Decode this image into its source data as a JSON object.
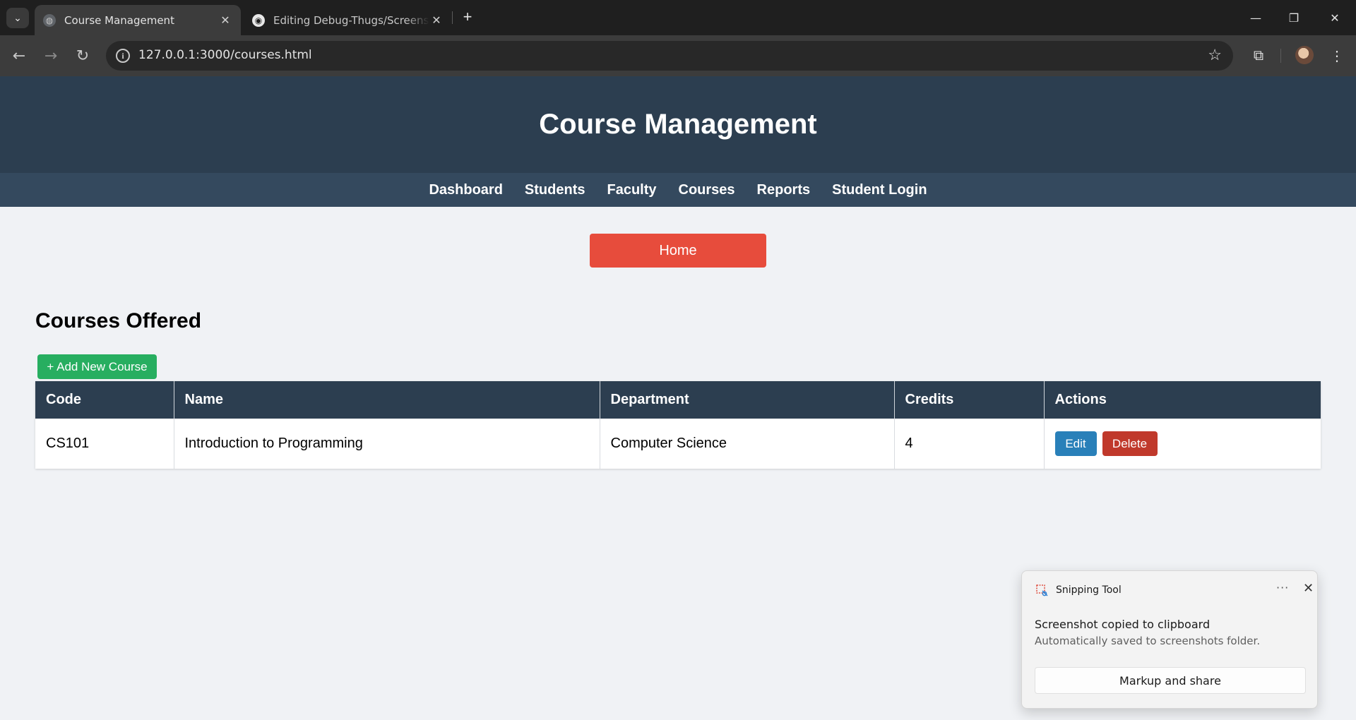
{
  "browser": {
    "tabs": [
      {
        "title": "Course Management",
        "active": true
      },
      {
        "title": "Editing Debug-Thugs/Screenshots",
        "active": false
      }
    ],
    "url": "127.0.0.1:3000/courses.html",
    "icons": {
      "tab_search": "chevron-down-icon",
      "tab_close": "close-icon",
      "new_tab": "plus-icon",
      "back": "arrow-left-icon",
      "forward": "arrow-right-icon",
      "reload": "reload-icon",
      "site_info": "info-icon",
      "bookmark": "star-icon",
      "extensions": "puzzle-icon",
      "menu": "kebab-menu-icon"
    },
    "glyphs": {
      "chevron": "⌄",
      "close": "✕",
      "plus": "+",
      "back": "←",
      "forward": "→",
      "reload": "↻",
      "info": "i",
      "star": "☆",
      "puzzle": "⧉",
      "menu": "⋮",
      "minimize": "—",
      "restore": "❐",
      "github": "◉",
      "globe": "◍"
    }
  },
  "site": {
    "title": "Course Management",
    "nav": [
      "Dashboard",
      "Students",
      "Faculty",
      "Courses",
      "Reports",
      "Student Login"
    ],
    "colors": {
      "header": "#2c3e50",
      "nav": "#34495e",
      "home": "#e74c3c",
      "add": "#27ae60",
      "edit": "#2980b9",
      "delete": "#c0392b"
    }
  },
  "main": {
    "home_label": "Home",
    "section_title": "Courses Offered",
    "add_label": "+ Add New Course",
    "table": {
      "headers": [
        "Code",
        "Name",
        "Department",
        "Credits",
        "Actions"
      ],
      "rows": [
        {
          "code": "CS101",
          "name": "Introduction to Programming",
          "department": "Computer Science",
          "credits": "4",
          "edit_label": "Edit",
          "delete_label": "Delete"
        }
      ]
    }
  },
  "toast": {
    "app_name": "Snipping Tool",
    "more": "···",
    "close": "✕",
    "line1": "Screenshot copied to clipboard",
    "line2": "Automatically saved to screenshots folder.",
    "button_label": "Markup and share"
  }
}
